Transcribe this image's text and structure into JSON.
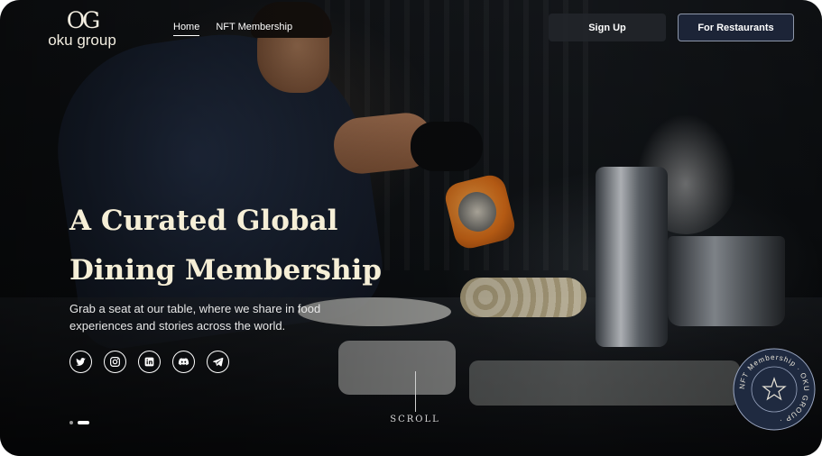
{
  "brand": {
    "mark": "OG",
    "name": "oku group"
  },
  "nav": [
    {
      "label": "Home",
      "active": true
    },
    {
      "label": "NFT Membership",
      "active": false
    }
  ],
  "header_buttons": {
    "sign_up": "Sign Up",
    "for_restaurants": "For Restaurants"
  },
  "hero": {
    "headline_line1": "A Curated Global",
    "headline_line2": "Dining Membership",
    "subtext": "Grab a seat at our table, where we share in food experiences and stories across the world."
  },
  "socials": [
    "twitter-icon",
    "instagram-icon",
    "linkedin-icon",
    "discord-icon",
    "telegram-icon"
  ],
  "slider": {
    "count": 2,
    "active_index": 1
  },
  "scroll_label": "SCROLL",
  "badge": {
    "ring_text": "NFT Membership · OKU GROUP ·",
    "icon": "star-icon"
  },
  "colors": {
    "headline": "#f6efd7",
    "accent_button": "#1c2437",
    "signup_button": "#22252a"
  }
}
